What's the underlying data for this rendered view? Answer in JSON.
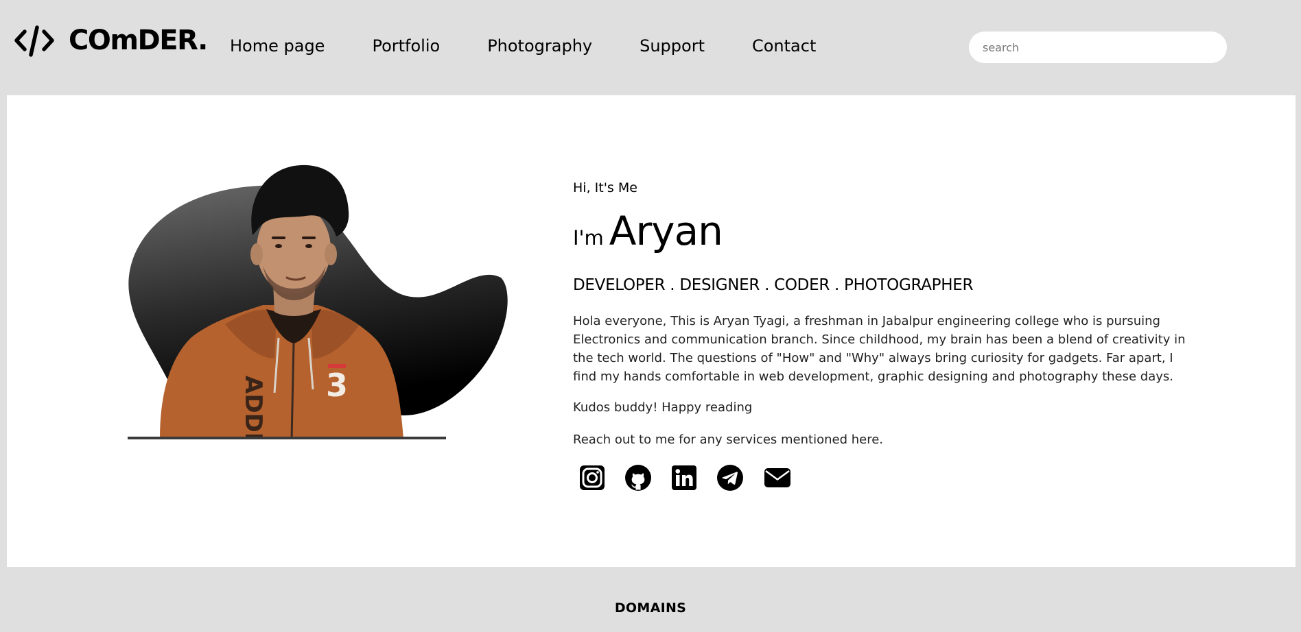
{
  "brand": {
    "name": "COmDER.",
    "icon": "code-brackets-icon"
  },
  "nav": {
    "items": [
      {
        "label": "Home page"
      },
      {
        "label": "Portfolio"
      },
      {
        "label": "Photography"
      },
      {
        "label": "Support"
      },
      {
        "label": "Contact"
      }
    ]
  },
  "search": {
    "placeholder": "search",
    "value": ""
  },
  "hero": {
    "image": "portrait-photo",
    "greeting": "Hi, It's Me",
    "im": "I'm",
    "name": "Aryan",
    "roles": "DEVELOPER . DESIGNER . CODER . PHOTOGRAPHER",
    "bio": "Hola everyone, This is Aryan Tyagi, a freshman in Jabalpur engineering college who is pursuing Electronics and communication branch. Since childhood, my brain has been a blend of creativity in the tech world. The questions of \"How\" and \"Why\" always bring curiosity for gadgets. Far apart, I find my hands comfortable in web development, graphic designing and photography these days.",
    "kudos": "Kudos buddy! Happy reading",
    "reach": "Reach out to me for any services mentioned here.",
    "socials": [
      {
        "icon": "instagram-icon"
      },
      {
        "icon": "github-icon"
      },
      {
        "icon": "linkedin-icon"
      },
      {
        "icon": "telegram-icon"
      },
      {
        "icon": "mail-icon"
      }
    ],
    "hoodie_print": "ADDI",
    "hoodie_number": "3"
  },
  "domains": {
    "title": "DOMAINS"
  },
  "colors": {
    "page_bg": "#dfdfdf",
    "panel_bg": "#ffffff",
    "text": "#000000",
    "hoodie": "#b5622f"
  }
}
